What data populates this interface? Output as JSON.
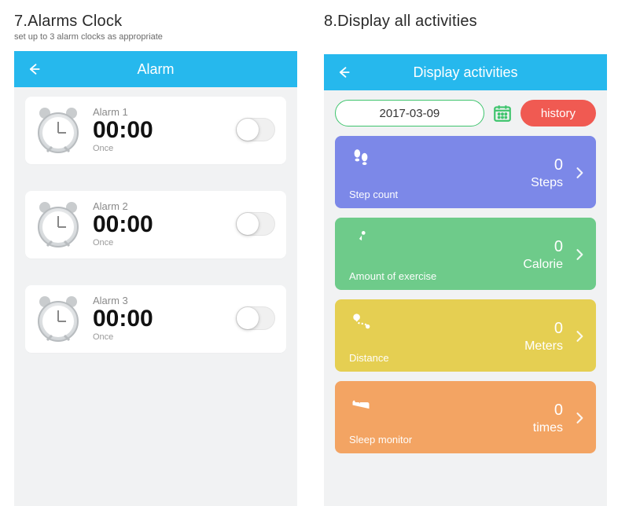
{
  "left": {
    "heading": "7.Alarms Clock",
    "sub": "set up to 3 alarm clocks as appropriate",
    "navbar_title": "Alarm",
    "alarms": [
      {
        "name": "Alarm 1",
        "time": "00:00",
        "repeat": "Once"
      },
      {
        "name": "Alarm 2",
        "time": "00:00",
        "repeat": "Once"
      },
      {
        "name": "Alarm 3",
        "time": "00:00",
        "repeat": "Once"
      }
    ]
  },
  "right": {
    "heading": "8.Display all activities",
    "navbar_title": "Display activities",
    "date": "2017-03-09",
    "history_label": "history",
    "cards": [
      {
        "label": "Step count",
        "value": "0",
        "unit": "Steps"
      },
      {
        "label": "Amount of exercise",
        "value": "0",
        "unit": "Calorie"
      },
      {
        "label": "Distance",
        "value": "0",
        "unit": "Meters"
      },
      {
        "label": "Sleep monitor",
        "value": "0",
        "unit": "times"
      }
    ]
  }
}
